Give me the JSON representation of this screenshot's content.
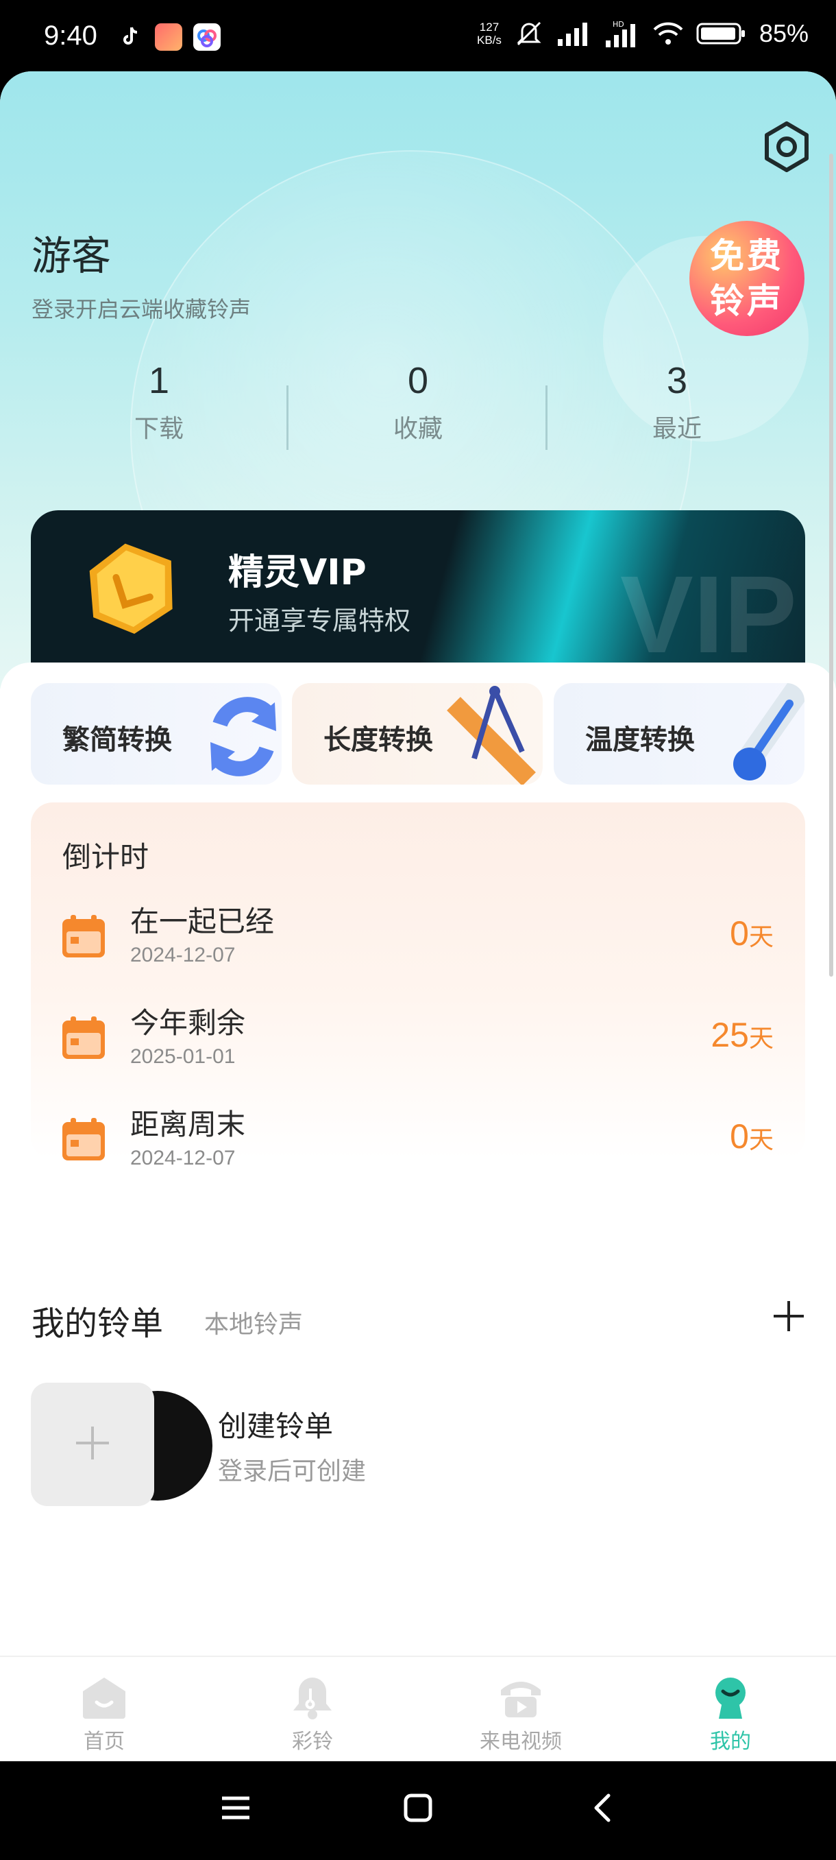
{
  "status_bar": {
    "time": "9:40",
    "net_speed_value": "127",
    "net_speed_unit": "KB/s",
    "battery": "85%"
  },
  "profile": {
    "username": "游客",
    "subtitle": "登录开启云端收藏铃声",
    "free_badge_line1": "免费",
    "free_badge_line2": "铃声"
  },
  "stats": [
    {
      "value": "1",
      "label": "下载"
    },
    {
      "value": "0",
      "label": "收藏"
    },
    {
      "value": "3",
      "label": "最近"
    }
  ],
  "vip": {
    "title": "精灵VIP",
    "subtitle": "开通享专属特权",
    "watermark": "VIP"
  },
  "tools": [
    {
      "label": "繁简转换",
      "icon": "refresh-icon"
    },
    {
      "label": "长度转换",
      "icon": "ruler-compass-icon"
    },
    {
      "label": "温度转换",
      "icon": "thermometer-icon"
    }
  ],
  "countdown": {
    "heading": "倒计时",
    "items": [
      {
        "name": "在一起已经",
        "date": "2024-12-07",
        "value": "0",
        "unit": "天"
      },
      {
        "name": "今年剩余",
        "date": "2025-01-01",
        "value": "25",
        "unit": "天"
      },
      {
        "name": "距离周末",
        "date": "2024-12-07",
        "value": "0",
        "unit": "天"
      }
    ]
  },
  "playlist": {
    "title": "我的铃单",
    "local_tab": "本地铃声",
    "create_title": "创建铃单",
    "create_subtitle": "登录后可创建"
  },
  "tabbar": [
    {
      "label": "首页",
      "icon": "home-icon"
    },
    {
      "label": "彩铃",
      "icon": "bell-icon"
    },
    {
      "label": "来电视频",
      "icon": "phone-video-icon"
    },
    {
      "label": "我的",
      "icon": "profile-icon",
      "active": true
    }
  ],
  "colors": {
    "accent": "#2ec4a8",
    "countdown_value": "#f5882d",
    "vip_bg": "#0b1d24"
  }
}
